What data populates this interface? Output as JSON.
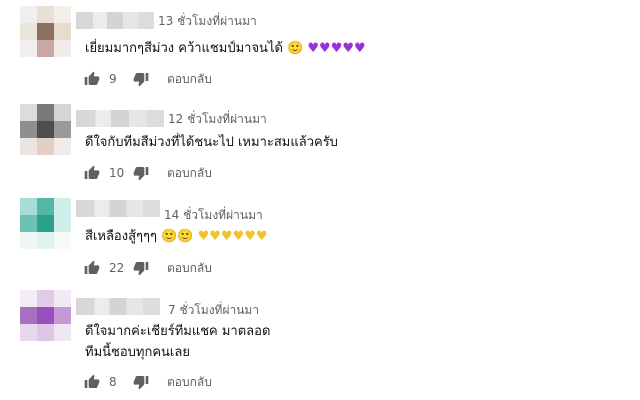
{
  "comments": [
    {
      "time": "13 ชั่วโมงที่ผ่านมา",
      "lines": [
        "เยี่ยมมากๆสีม่วง คว้าแชมป์มาจนได้"
      ],
      "emoji": "🙂",
      "hearts": "♥♥♥♥♥",
      "likes": "9",
      "reply_label": "ตอบกลับ",
      "avatar": [
        "#efefef",
        "#e6e0d6",
        "#f3efe9",
        "#ebe6dc",
        "#8b715e",
        "#e8dccd",
        "#f2f0ee",
        "#caa6a6",
        "#f2ecea"
      ]
    },
    {
      "time": "12 ชั่วโมงที่ผ่านมา",
      "lines": [
        "ดีใจกับทีมสีม่วงที่ได้ชนะไป เหมาะสมแล้วครับ"
      ],
      "likes": "10",
      "reply_label": "ตอบกลับ",
      "avatar": [
        "#dcdcdc",
        "#7a7a7a",
        "#d6d6d6",
        "#8f8f8f",
        "#4e4e4e",
        "#9a9a9a",
        "#ece4e0",
        "#e4cfc6",
        "#f1ebe8"
      ]
    },
    {
      "time": "14 ชั่วโมงที่ผ่านมา",
      "lines": [
        "สีเหลืองสู้ๆๆๆ"
      ],
      "emoji": "🙂🙂",
      "hearts": "♥♥♥♥♥♥",
      "likes": "22",
      "reply_label": "ตอบกลับ",
      "avatar": [
        "#a6ddd5",
        "#52b7a6",
        "#cfeee9",
        "#6cc2b4",
        "#2ea08e",
        "#cfeee9",
        "#eff8f6",
        "#e0f3f0",
        "#f6fbfa"
      ]
    },
    {
      "time": "7 ชั่วโมงที่ผ่านมา",
      "lines": [
        "ดีใจมากค่ะเชียร์ทีมแชค มาตลอด",
        "ทีมนี้ชอบทุกคนเลย"
      ],
      "likes": "8",
      "reply_label": "ตอบกลับ",
      "avatar": [
        "#f3eef6",
        "#e1cbe8",
        "#f1eaf4",
        "#a970c2",
        "#9a4fbf",
        "#c49ad6",
        "#e8d8ee",
        "#ddc6e6",
        "#efe6f3"
      ]
    }
  ]
}
